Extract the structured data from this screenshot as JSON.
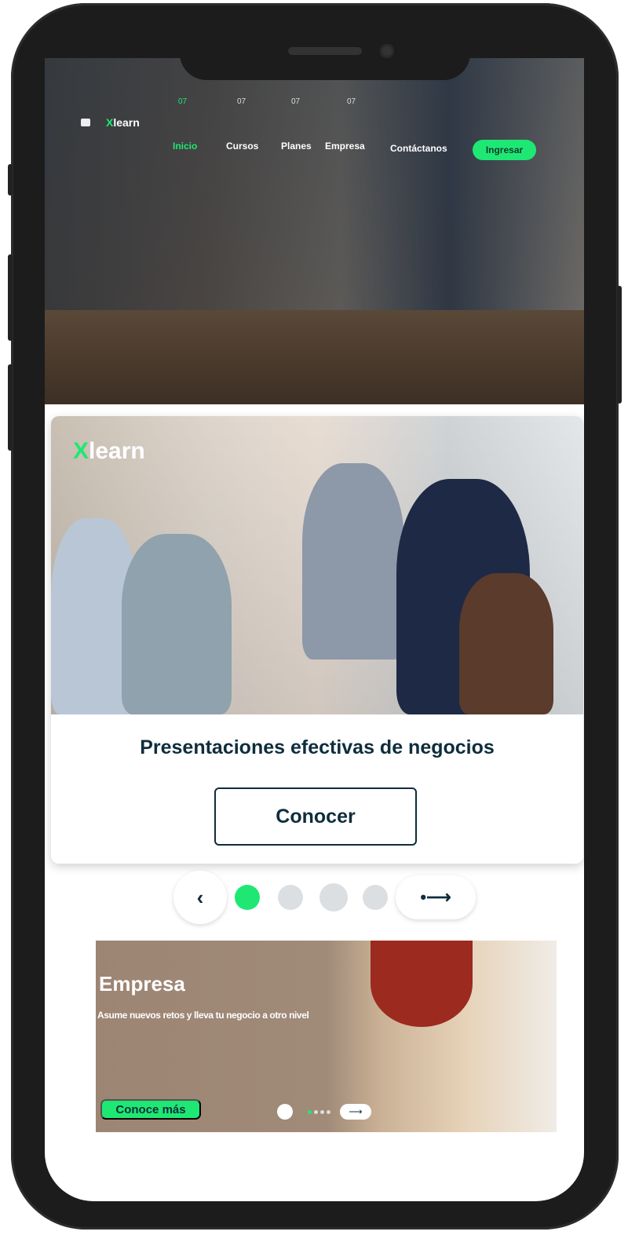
{
  "nav": {
    "logo": {
      "x": "X",
      "rest": "learn"
    },
    "items": [
      {
        "label": "Inicio",
        "num": "07",
        "active": true
      },
      {
        "label": "Cursos",
        "num": "07"
      },
      {
        "label": "Planes",
        "num": "07"
      },
      {
        "label": "Empresa",
        "num": "07"
      },
      {
        "label": "Contáctanos"
      }
    ],
    "login": "Ingresar"
  },
  "card": {
    "logo": {
      "x": "X",
      "rest": "learn"
    },
    "title": "Presentaciones efectivas de negocios",
    "button": "Conocer"
  },
  "carousel": {
    "prev": "‹",
    "next": "•⟶",
    "pages": 4,
    "active_index": 0
  },
  "banner": {
    "title": "Empresa",
    "subtitle": "Asume nuevos retos y lleva tu negocio a otro nivel",
    "button": "Conoce más",
    "next": "⟶"
  },
  "colors": {
    "accent": "#1ee873",
    "dark": "#0f2d3c",
    "frame": "#1c1c1c"
  }
}
